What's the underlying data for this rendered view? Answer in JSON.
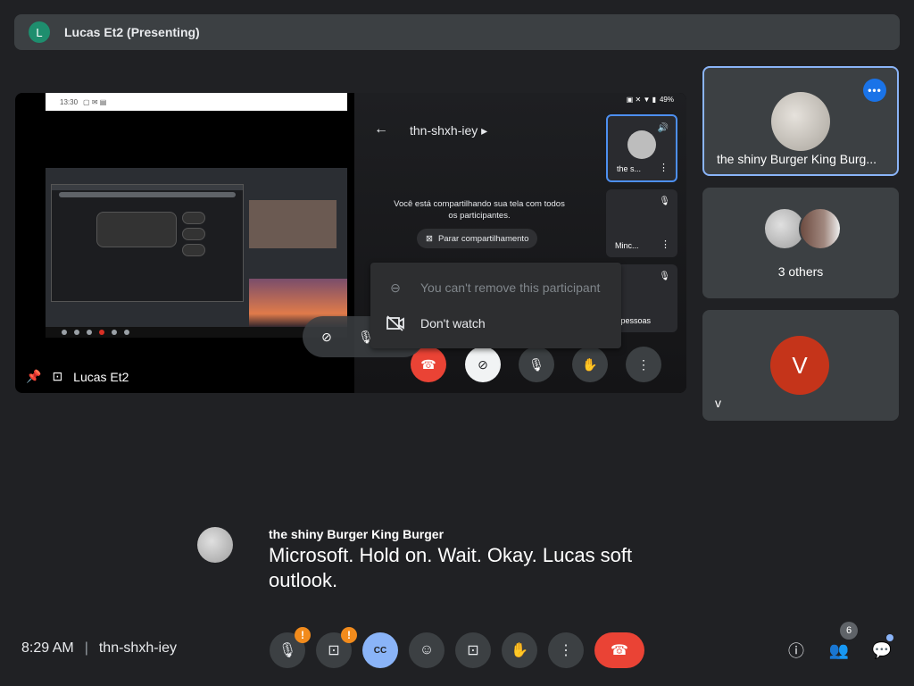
{
  "topbar": {
    "avatar_letter": "L",
    "title": "Lucas Et2 (Presenting)"
  },
  "presentation": {
    "presenter_label": "Lucas Et2",
    "pc_time": "13:30",
    "phone": {
      "battery": "49%",
      "meeting_code": "thn-shxh-iey",
      "share_text": "Você está compartilhando sua tela com todos os participantes.",
      "stop_share": "Parar compartilhamento",
      "tile1_label": "the s...",
      "tile2_label": "Minc...",
      "tile3_label": "s 2 pessoas"
    }
  },
  "popup_menu": {
    "items": [
      {
        "label": "You can't remove this participant",
        "icon": "remove-circle-icon",
        "disabled": true
      },
      {
        "label": "Don't watch",
        "icon": "video-off-icon",
        "disabled": false
      }
    ]
  },
  "participants": [
    {
      "name": "the shiny Burger King Burg...",
      "highlighted": true
    },
    {
      "name": "3 others"
    },
    {
      "name": "v",
      "avatar_letter": "V",
      "avatar_color": "#c5341a"
    }
  ],
  "caption": {
    "speaker": "the shiny Burger King Burger",
    "text": "Microsoft. Hold on. Wait. Okay. Lucas soft outlook."
  },
  "bottombar": {
    "time": "8:29 AM",
    "meeting_code": "thn-shxh-iey",
    "cc_label": "CC",
    "people_count": "6"
  },
  "colors": {
    "end_call": "#ea4335",
    "accent": "#8ab4f8",
    "warning": "#f28b1c"
  }
}
